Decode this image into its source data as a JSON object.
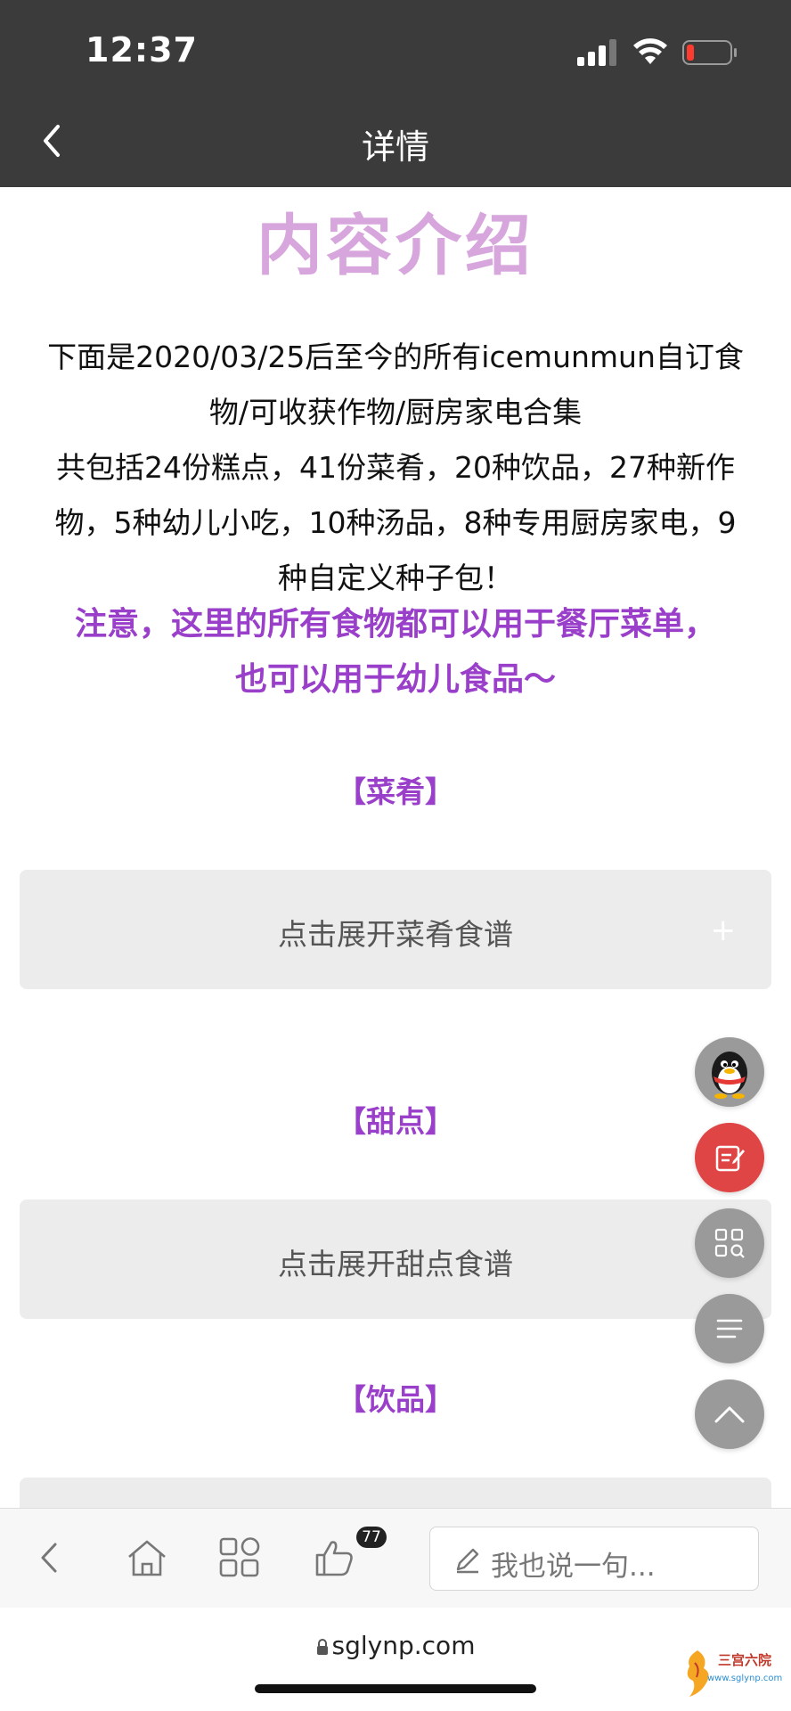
{
  "status_bar": {
    "time": "12:37"
  },
  "nav": {
    "title": "详情"
  },
  "intro": {
    "title": "内容介绍",
    "body_lines": [
      "下面是2020/03/25后至今的所有icemunmun自订食",
      "物/可收获作物/厨房家电合集",
      "共包括24份糕点，41份菜肴，20种饮品，27种新作",
      "物，5种幼儿小吃，10种汤品，8种专用厨房家电，9",
      "种自定义种子包！"
    ],
    "note_lines": [
      "注意，这里的所有食物都可以用于餐厅菜单，",
      "也可以用于幼儿食品～"
    ]
  },
  "sections": [
    {
      "heading": "【菜肴】",
      "button_label": "点击展开菜肴食谱"
    },
    {
      "heading": "【甜点】",
      "button_label": "点击展开甜点食谱"
    },
    {
      "heading": "【饮品】"
    }
  ],
  "toolbar": {
    "like_count": "77",
    "comment_placeholder": "我也说一句..."
  },
  "url_bar": {
    "domain": "sglynp.com"
  },
  "watermark": {
    "text": "三宫六院",
    "url": "www.sglynp.com"
  },
  "colors": {
    "title_pink": "#d7a6dc",
    "accent_purple": "#9a3fc9",
    "fab_red": "#e04545",
    "chrome_dark": "#3b3b3b"
  }
}
